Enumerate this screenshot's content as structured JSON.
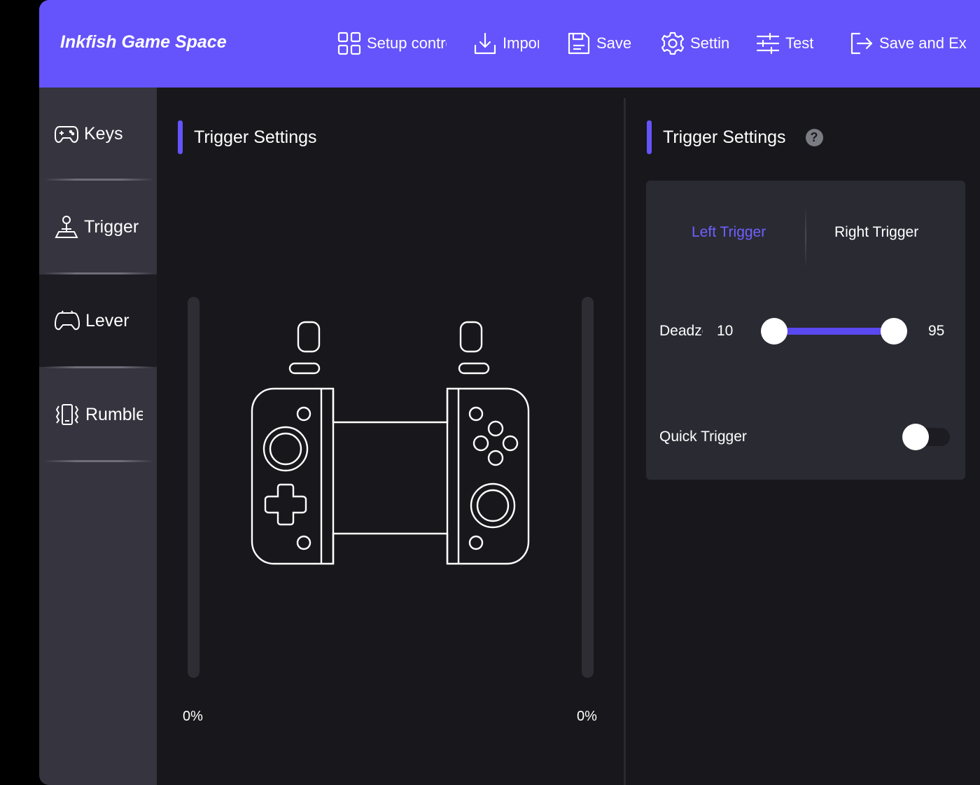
{
  "app": {
    "title": "Inkfish Game Space"
  },
  "toolbar": {
    "setup_label": "Setup controller",
    "import_label": "Import",
    "save_label": "Save",
    "settings_label": "Settings",
    "test_label": "Test",
    "save_exit_label": "Save and Exit"
  },
  "sidebar": {
    "items": [
      {
        "label": "Keys",
        "icon": "gamepad-icon"
      },
      {
        "label": "Trigger",
        "icon": "joystick-icon"
      },
      {
        "label": "Lever",
        "icon": "controller-icon",
        "active": true
      },
      {
        "label": "Rumble",
        "icon": "vibration-icon"
      }
    ]
  },
  "preview": {
    "title": "Trigger Settings",
    "left_value": "0%",
    "right_value": "0%"
  },
  "settings": {
    "title": "Trigger Settings",
    "help": "?",
    "tabs": [
      {
        "label": "Left Trigger",
        "active": true
      },
      {
        "label": "Right Trigger",
        "active": false
      }
    ],
    "deadzone": {
      "label": "Deadzone",
      "min_value": "10",
      "max_value": "95",
      "min": 10,
      "max": 95
    },
    "quick_trigger": {
      "label": "Quick Trigger",
      "enabled": false
    }
  },
  "colors": {
    "accent": "#6553fb",
    "tab_active": "#6e61ff"
  }
}
